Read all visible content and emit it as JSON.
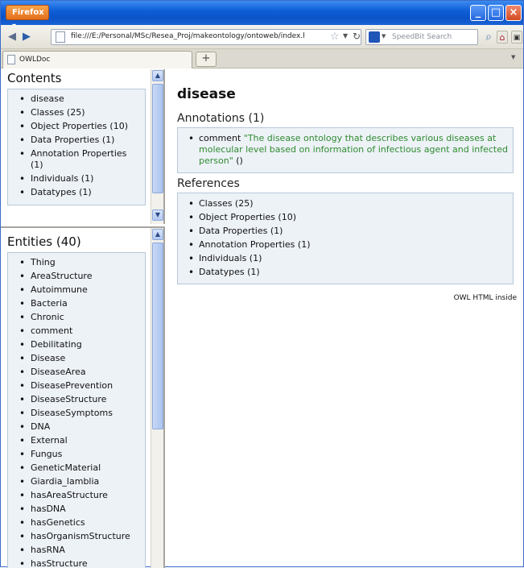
{
  "browser": {
    "menu_label": "Firefox",
    "url": "file:///E:/Personal/MSc/Resea_Proj/makeontology/ontoweb/index.htr",
    "search_placeholder": "SpeedBit Search",
    "tab_title": "OWLDoc",
    "new_tab_label": "+"
  },
  "contents": {
    "title": "Contents",
    "items": [
      "disease",
      "Classes (25)",
      "Object Properties (10)",
      "Data Properties (1)",
      "Annotation Properties (1)",
      "Individuals (1)",
      "Datatypes (1)"
    ]
  },
  "entities": {
    "title": "Entities (40)",
    "items": [
      "Thing",
      "AreaStructure",
      "Autoimmune",
      "Bacteria",
      "Chronic",
      "comment",
      "Debilitating",
      "Disease",
      "DiseaseArea",
      "DiseasePrevention",
      "DiseaseStructure",
      "DiseaseSymptoms",
      "DNA",
      "External",
      "Fungus",
      "GeneticMaterial",
      "Giardia_lamblia",
      "hasAreaStructure",
      "hasDNA",
      "hasGenetics",
      "hasOrganismStructure",
      "hasRNA",
      "hasStructure"
    ]
  },
  "main": {
    "title": "disease",
    "annotations_title": "Annotations (1)",
    "annotation": {
      "label": "comment",
      "value": "\"The disease ontology that describes various diseases at molecular level based on information of infectious agent and infected person\"",
      "suffix": "()"
    },
    "references_title": "References",
    "references": [
      "Classes (25)",
      "Object Properties (10)",
      "Data Properties (1)",
      "Annotation Properties (1)",
      "Individuals (1)",
      "Datatypes (1)"
    ],
    "footer": "OWL HTML inside"
  },
  "colors": {
    "titlebar": "#0f5fd8",
    "firefox_button": "#e4701c",
    "box_background": "#edf2f7",
    "box_border": "#b7c7d9",
    "comment_text": "#2f8a2f"
  }
}
